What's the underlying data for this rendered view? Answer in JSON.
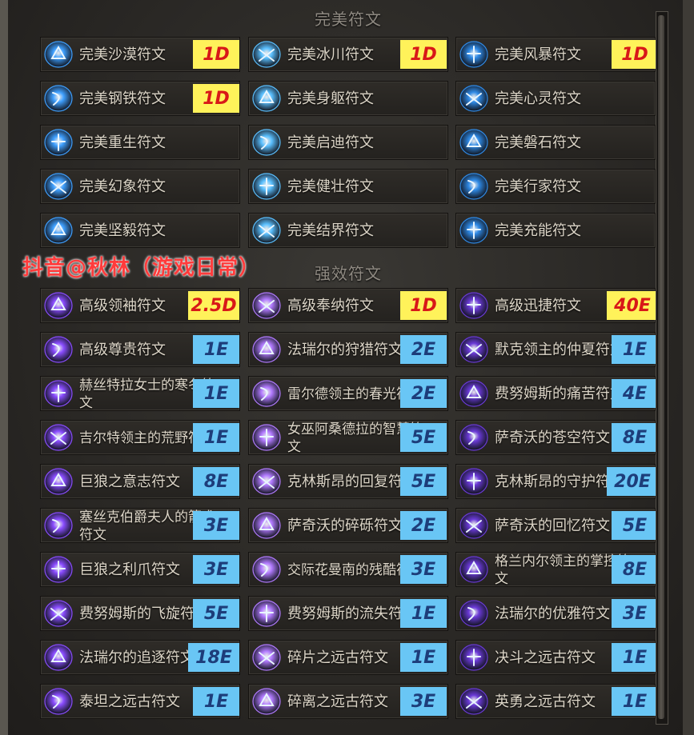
{
  "sections": [
    {
      "title": "完美符文",
      "runes": [
        {
          "name": "完美沙漠符文",
          "price": "1D",
          "tag_color": "yellow"
        },
        {
          "name": "完美冰川符文",
          "price": "1D",
          "tag_color": "yellow"
        },
        {
          "name": "完美风暴符文",
          "price": "1D",
          "tag_color": "yellow"
        },
        {
          "name": "完美钢铁符文",
          "price": "1D",
          "tag_color": "yellow"
        },
        {
          "name": "完美身躯符文",
          "price": ""
        },
        {
          "name": "完美心灵符文",
          "price": ""
        },
        {
          "name": "完美重生符文",
          "price": ""
        },
        {
          "name": "完美启迪符文",
          "price": ""
        },
        {
          "name": "完美磐石符文",
          "price": ""
        },
        {
          "name": "完美幻象符文",
          "price": ""
        },
        {
          "name": "完美健壮符文",
          "price": ""
        },
        {
          "name": "完美行家符文",
          "price": ""
        },
        {
          "name": "完美坚毅符文",
          "price": ""
        },
        {
          "name": "完美结界符文",
          "price": ""
        },
        {
          "name": "完美充能符文",
          "price": ""
        }
      ]
    },
    {
      "title": "强效符文",
      "runes": [
        {
          "name": "高级领袖符文",
          "price": "2.5D",
          "tag_color": "yellow"
        },
        {
          "name": "高级奉纳符文",
          "price": "1D",
          "tag_color": "yellow"
        },
        {
          "name": "高级迅捷符文",
          "price": "40E",
          "tag_color": "yellow"
        },
        {
          "name": "高级尊贵符文",
          "price": "1E",
          "tag_color": "blue"
        },
        {
          "name": "法瑞尔的狩猎符文",
          "price": "2E",
          "tag_color": "blue"
        },
        {
          "name": "默克领主的仲夏符文",
          "price": "1E",
          "tag_color": "blue"
        },
        {
          "name": "赫丝特拉女士的寒冬符文",
          "price": "1E",
          "tag_color": "blue"
        },
        {
          "name": "雷尔德领主的春光符文",
          "price": "2E",
          "tag_color": "blue"
        },
        {
          "name": "费努姆斯的痛苦符文",
          "price": "4E",
          "tag_color": "blue"
        },
        {
          "name": "吉尔特领主的荒野符文",
          "price": "1E",
          "tag_color": "blue"
        },
        {
          "name": "女巫阿桑德拉的智慧符文",
          "price": "5E",
          "tag_color": "blue"
        },
        {
          "name": "萨奇沃的苍空符文",
          "price": "8E",
          "tag_color": "blue"
        },
        {
          "name": "巨狼之意志符文",
          "price": "8E",
          "tag_color": "blue"
        },
        {
          "name": "克林斯昂的回复符文",
          "price": "5E",
          "tag_color": "blue"
        },
        {
          "name": "克林斯昂的守护符文",
          "price": "20E",
          "tag_color": "blue"
        },
        {
          "name": "塞丝克伯爵夫人的箭术符文",
          "price": "3E",
          "tag_color": "blue"
        },
        {
          "name": "萨奇沃的碎砾符文",
          "price": "2E",
          "tag_color": "blue"
        },
        {
          "name": "萨奇沃的回忆符文",
          "price": "5E",
          "tag_color": "blue"
        },
        {
          "name": "巨狼之利爪符文",
          "price": "3E",
          "tag_color": "blue"
        },
        {
          "name": "交际花曼南的残酷符文",
          "price": "3E",
          "tag_color": "blue"
        },
        {
          "name": "格兰内尔领主的掌控符文",
          "price": "8E",
          "tag_color": "blue"
        },
        {
          "name": "费努姆斯的飞旋符文",
          "price": "5E",
          "tag_color": "blue"
        },
        {
          "name": "费努姆斯的流失符文",
          "price": "1E",
          "tag_color": "blue"
        },
        {
          "name": "法瑞尔的优雅符文",
          "price": "3E",
          "tag_color": "blue"
        },
        {
          "name": "法瑞尔的追逐符文",
          "price": "18E",
          "tag_color": "blue"
        },
        {
          "name": "碎片之远古符文",
          "price": "1E",
          "tag_color": "blue"
        },
        {
          "name": "决斗之远古符文",
          "price": "1E",
          "tag_color": "blue"
        },
        {
          "name": "泰坦之远古符文",
          "price": "1E",
          "tag_color": "blue"
        },
        {
          "name": "碎离之远古符文",
          "price": "3E",
          "tag_color": "blue"
        },
        {
          "name": "英勇之远古符文",
          "price": "1E",
          "tag_color": "blue"
        }
      ]
    }
  ],
  "watermark": "抖音@秋林（游戏日常）",
  "colors": {
    "yellow_tag_bg": "#fff25a",
    "yellow_tag_text": "#d81818",
    "blue_tag_bg": "#69c6f5",
    "blue_tag_text": "#1d3d7a"
  }
}
